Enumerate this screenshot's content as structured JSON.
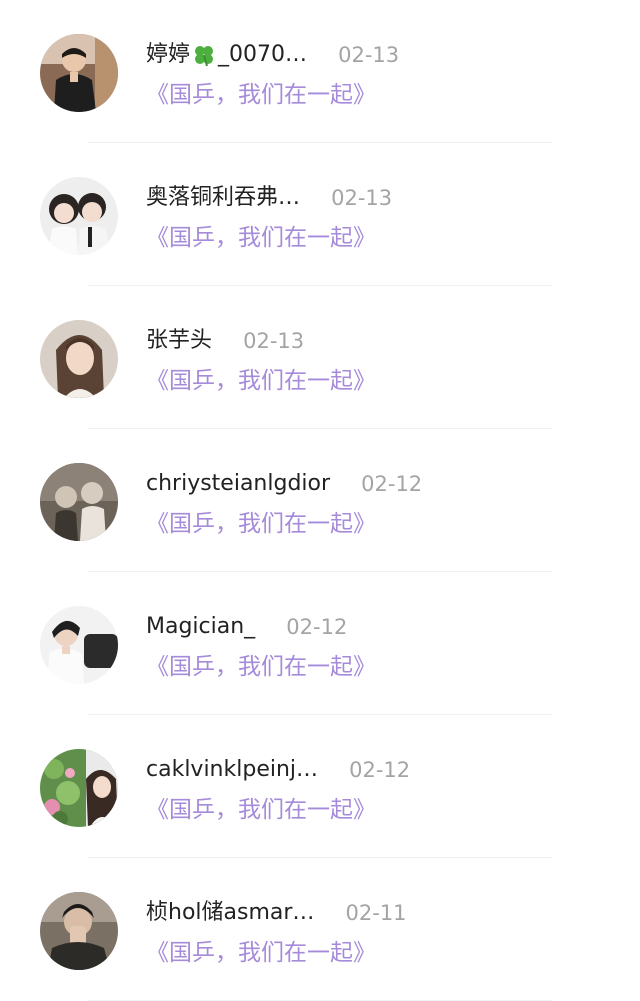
{
  "items": [
    {
      "name_prefix": "婷婷",
      "name_suffix": "_0070…",
      "has_leaf": true,
      "date": "02-13",
      "title": "《国乒，我们在一起》",
      "avatar": "avatar-man-dark-jacket"
    },
    {
      "name_prefix": "奥落铜利吞弗…",
      "name_suffix": "",
      "has_leaf": false,
      "date": "02-13",
      "title": "《国乒，我们在一起》",
      "avatar": "avatar-two-children"
    },
    {
      "name_prefix": "张芋头",
      "name_suffix": "",
      "has_leaf": false,
      "date": "02-13",
      "title": "《国乒，我们在一起》",
      "avatar": "avatar-long-hair-woman"
    },
    {
      "name_prefix": "chriysteianlgdior",
      "name_suffix": "",
      "has_leaf": false,
      "date": "02-12",
      "title": "《国乒，我们在一起》",
      "avatar": "avatar-vintage-children"
    },
    {
      "name_prefix": "Magician_",
      "name_suffix": "",
      "has_leaf": false,
      "date": "02-12",
      "title": "《国乒，我们在一起》",
      "avatar": "avatar-man-in-car"
    },
    {
      "name_prefix": "caklvinklpeinj…",
      "name_suffix": "",
      "has_leaf": false,
      "date": "02-12",
      "title": "《国乒，我们在一起》",
      "avatar": "avatar-woman-flowers"
    },
    {
      "name_prefix": "桢hol储asmar…",
      "name_suffix": "",
      "has_leaf": false,
      "date": "02-11",
      "title": "《国乒，我们在一起》",
      "avatar": "avatar-man-hand-face"
    }
  ],
  "colors": {
    "name": "#222222",
    "date": "#a4a4a4",
    "title": "#a58bd9",
    "leaf": "#4caf3e"
  }
}
